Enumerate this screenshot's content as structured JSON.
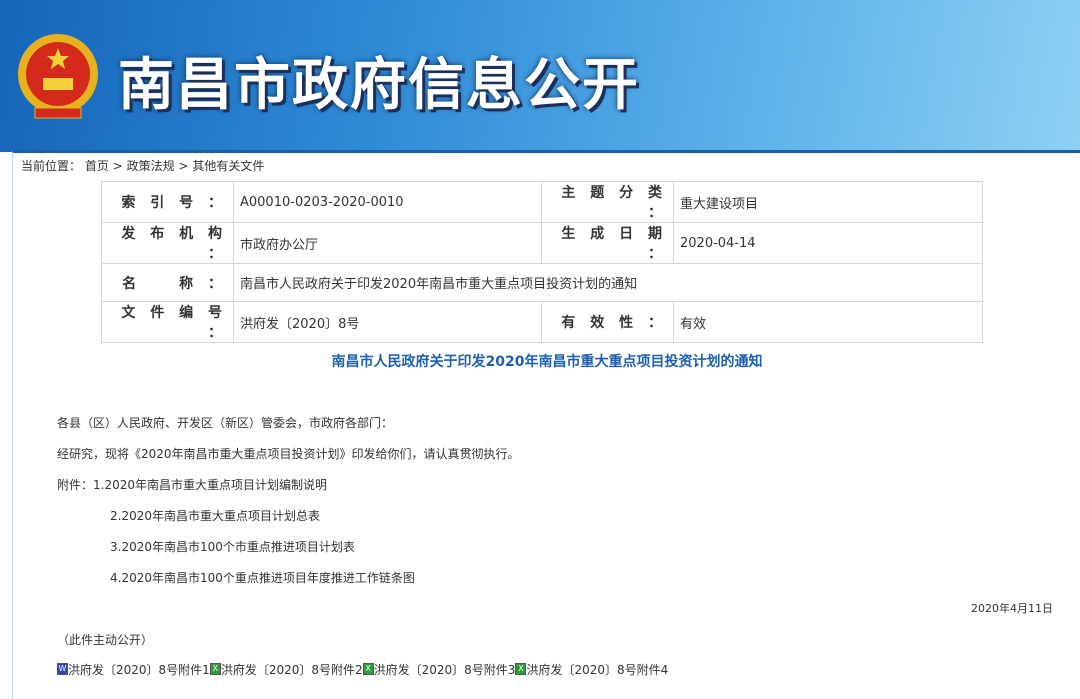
{
  "header": {
    "title": "南昌市政府信息公开"
  },
  "breadcrumb": {
    "label": "当前位置：",
    "items": [
      "首页",
      "政策法规",
      "其他有关文件"
    ],
    "sep": ">"
  },
  "meta": {
    "index_label": "索 引 号 ：",
    "index_value": "A00010-0203-2020-0010",
    "topic_label": "主 题 分 类 ：",
    "topic_value": "重大建设项目",
    "publisher_label": "发 布 机 构 ：",
    "publisher_value": "市政府办公厅",
    "date_label": "生 成 日 期 ：",
    "date_value": "2020-04-14",
    "name_label": "名　　称 ：",
    "name_value": "南昌市人民政府关于印发2020年南昌市重大重点项目投资计划的通知",
    "docno_label": "文 件 编 号 ：",
    "docno_value": "洪府发〔2020〕8号",
    "validity_label": "有 效 性 ：",
    "validity_value": "有效"
  },
  "doc": {
    "title": "南昌市人民政府关于印发2020年南昌市重大重点项目投资计划的通知",
    "salutation": "各县（区）人民政府、开发区（新区）管委会，市政府各部门：",
    "body": "经研究，现将《2020年南昌市重大重点项目投资计划》印发给你们，请认真贯彻执行。",
    "attach_prefix": "附件：",
    "attachments_list": [
      "1.2020年南昌市重大重点项目计划编制说明",
      "2.2020年南昌市重大重点项目计划总表",
      "3.2020年南昌市100个市重点推进项目计划表",
      "4.2020年南昌市100个重点推进项目年度推进工作链条图"
    ],
    "date": "2020年4月11日",
    "note": "（此件主动公开）",
    "files": [
      "洪府发〔2020〕8号附件1",
      "洪府发〔2020〕8号附件2",
      "洪府发〔2020〕8号附件3",
      "洪府发〔2020〕8号附件4"
    ]
  }
}
